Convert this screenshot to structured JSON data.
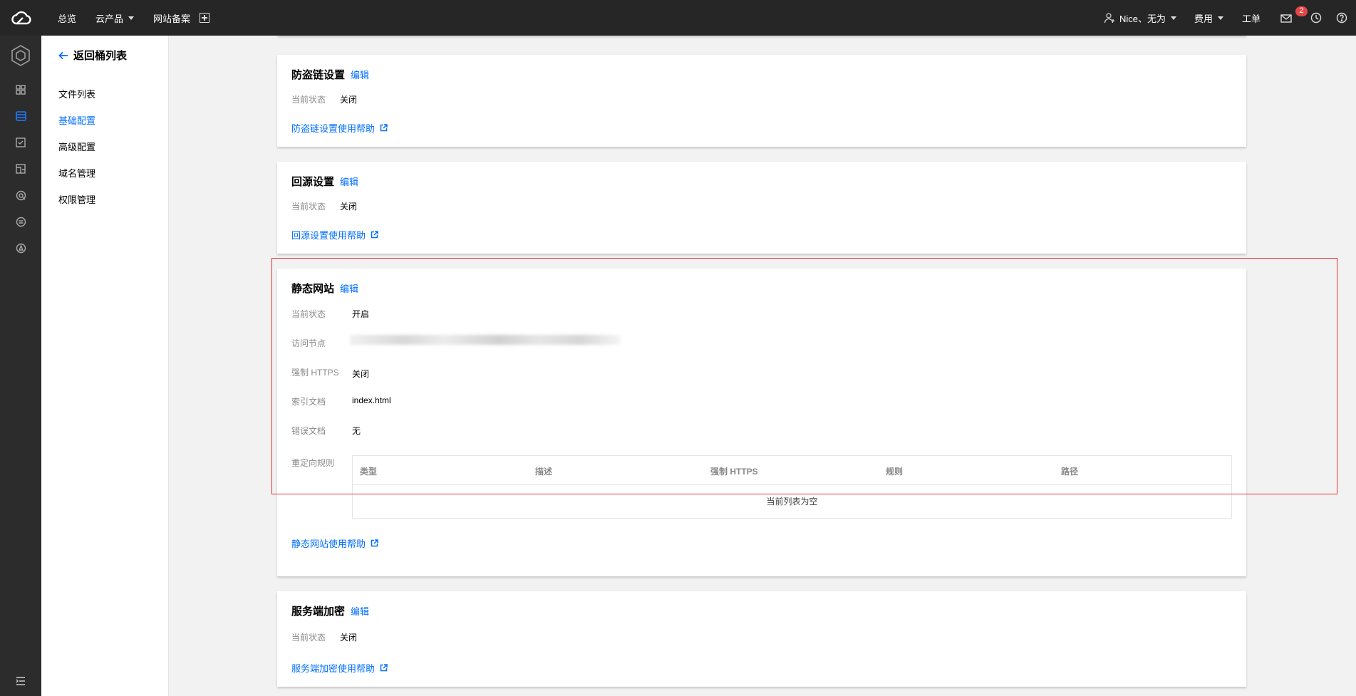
{
  "topbar": {
    "nav": [
      "总览",
      "云产品",
      "网站备案"
    ],
    "user": "Nice、无为",
    "fees": "费用",
    "ticket": "工单",
    "mail_badge": "2"
  },
  "sidebar": {
    "back_label": "返回桶列表",
    "items": [
      {
        "label": "文件列表",
        "active": false
      },
      {
        "label": "基础配置",
        "active": true
      },
      {
        "label": "高级配置",
        "active": false
      },
      {
        "label": "域名管理",
        "active": false
      },
      {
        "label": "权限管理",
        "active": false
      }
    ]
  },
  "sections": {
    "hotlink": {
      "title": "防盗链设置",
      "edit": "编辑",
      "status_label": "当前状态",
      "status_value": "关闭",
      "help": "防盗链设置使用帮助"
    },
    "origin": {
      "title": "回源设置",
      "edit": "编辑",
      "status_label": "当前状态",
      "status_value": "关闭",
      "help": "回源设置使用帮助"
    },
    "static_site": {
      "title": "静态网站",
      "edit": "编辑",
      "status_label": "当前状态",
      "status_value": "开启",
      "endpoint_label": "访问节点",
      "https_label": "强制 HTTPS",
      "https_value": "关闭",
      "index_label": "索引文档",
      "index_value": "index.html",
      "error_label": "错误文档",
      "error_value": "无",
      "redirect_label": "重定向规则",
      "table_headers": [
        "类型",
        "描述",
        "强制 HTTPS",
        "规则",
        "路径"
      ],
      "table_empty": "当前列表为空",
      "help": "静态网站使用帮助"
    },
    "encryption": {
      "title": "服务端加密",
      "edit": "编辑",
      "status_label": "当前状态",
      "status_value": "关闭",
      "help": "服务端加密使用帮助"
    }
  },
  "colors": {
    "topbar": "#262626",
    "rail": "#2c2c2c",
    "accent": "#006eff",
    "highlight": "#e53333",
    "badge": "#e54545"
  }
}
